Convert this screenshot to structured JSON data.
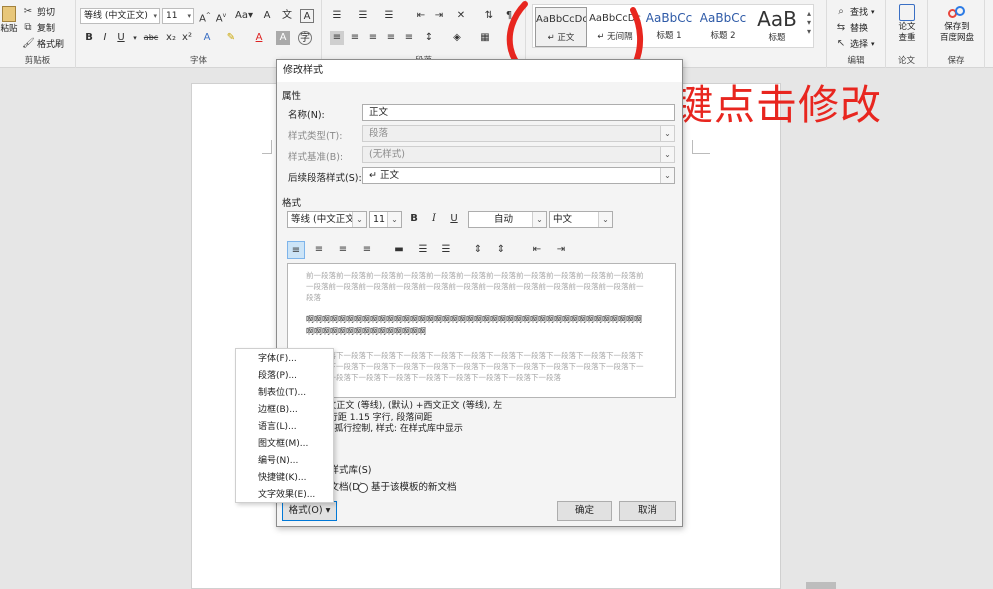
{
  "ribbon": {
    "clipboard": {
      "paste": "粘贴",
      "cut": "剪切",
      "copy": "复制",
      "format_painter": "格式刷",
      "label": "剪贴板"
    },
    "font": {
      "font_name": "等线 (中文正文)",
      "font_size": "11",
      "label": "字体"
    },
    "paragraph": {
      "label": "段落"
    },
    "styles": {
      "items": [
        {
          "sample": "AaBbCcDc",
          "name": "↵ 正文"
        },
        {
          "sample": "AaBbCcDc",
          "name": "↵ 无间隔"
        },
        {
          "sample": "AaBbCc",
          "name": "标题 1"
        },
        {
          "sample": "AaBbCc",
          "name": "标题 2"
        },
        {
          "sample": "AaB",
          "name": "标题"
        }
      ]
    },
    "editing": {
      "find": "查找",
      "replace": "替换",
      "select": "选择",
      "label": "编辑"
    },
    "paper": {
      "check": "论文\n查重",
      "label": "论文"
    },
    "save": {
      "save_to": "保存到\n百度网盘",
      "label": "保存"
    }
  },
  "annotation": "右键点击修改",
  "dialog": {
    "title": "修改样式",
    "properties_heading": "属性",
    "name_label": "名称(N):",
    "name_value": "正文",
    "type_label": "样式类型(T):",
    "type_value": "段落",
    "based_label": "样式基准(B):",
    "based_value": "(无样式)",
    "next_label": "后续段落样式(S):",
    "next_value": "↵ 正文",
    "format_heading": "格式",
    "font_name": "等线 (中文正文)",
    "font_size": "11",
    "bold": "B",
    "italic": "I",
    "underline": "U",
    "color": "自动",
    "language": "中文",
    "preview_prev": "前一段落前一段落前一段落前一段落前一段落前一段落前一段落前一段落前一段落前一段落前一段落前一段落前一段落前一段落前一段落前一段落前一段落前一段落前一段落前一段落前一段落前一段落前一段落",
    "preview_main": "啊啊啊啊啊啊啊啊啊啊啊啊啊啊啊啊啊啊啊啊啊啊啊啊啊啊啊啊啊啊啊啊啊啊啊啊啊啊啊啊啊啊啊啊啊啊啊啊啊啊啊啊啊啊啊啊啊",
    "preview_next": "下一段落下一段落下一段落下一段落下一段落下一段落下一段落下一段落下一段落下一段落下一段落下一段落下一段落下一段落下一段落下一段落下一段落下一段落下一段落下一段落下一段落下一段落下一段落下一段落下一段落下一段落下一段落下一段落下一段落下一段落下一段落",
    "desc_line1": "字体: +中文正文 (等线), (默认) +西文正文 (等线), 左",
    "desc_line2": "行距: 多倍行距 1.15 字行, 段落间距",
    "desc_line3": "段后: 8 磅, 孤行控制, 样式: 在样式库中显示",
    "add_to_gallery": "添加到样式库(S)",
    "only_this_doc": "仅限此文档(D)",
    "new_docs": "基于该模板的新文档",
    "format_button": "格式(O) ▾",
    "ok": "确定",
    "cancel": "取消"
  },
  "context_menu": {
    "items": [
      "字体(F)...",
      "段落(P)...",
      "制表位(T)...",
      "边框(B)...",
      "语言(L)...",
      "图文框(M)...",
      "编号(N)...",
      "快捷键(K)...",
      "文字效果(E)..."
    ]
  }
}
